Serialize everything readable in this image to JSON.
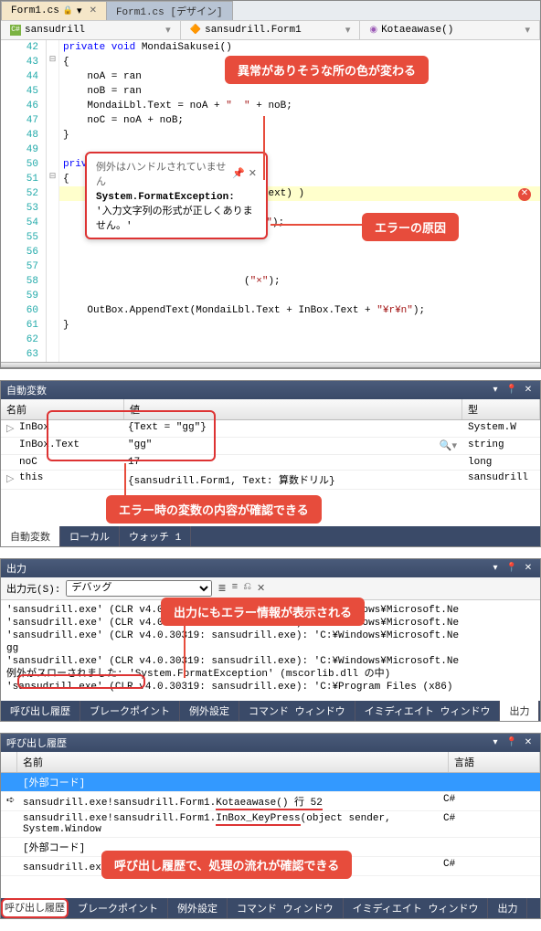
{
  "editor": {
    "tabs": [
      {
        "label": "Form1.cs",
        "active": true,
        "orange": true,
        "lock": true
      },
      {
        "label": "Form1.cs [デザイン]",
        "active": false
      }
    ],
    "breadcrumb": {
      "left": "sansudrill",
      "mid": "sansudrill.Form1",
      "right": "Kotaeawase()"
    },
    "lines": {
      "l42": "private void MondaiSakusei()",
      "l43": "{",
      "l44": "    noA = ran",
      "l45": "    noB = ran",
      "l46": "    MondaiLbl.Text = noA + \"  \" + noB;",
      "l47": "    noC = noA + noB;",
      "l48": "}",
      "l49": "",
      "l50": "private void Kotaeawase()",
      "l51": "{",
      "l52": "    if( noC == Int64.Parse(InBox.Text) )",
      "l53": "    {",
      "l54": "                              (\"〇\");",
      "l55": "",
      "l56": "",
      "l57": "",
      "l58": "                              (\"×\");",
      "l59": "",
      "l60": "    OutBox.AppendText(MondaiLbl.Text + InBox.Text + \"¥r¥n\");",
      "l61": "}",
      "l62": ""
    },
    "lineNums": [
      "42",
      "43",
      "44",
      "45",
      "46",
      "47",
      "48",
      "49",
      "50",
      "51",
      "52",
      "53",
      "54",
      "55",
      "56",
      "57",
      "58",
      "59",
      "60",
      "61",
      "62",
      "63"
    ],
    "tooltip": {
      "header": "例外はハンドルされていません",
      "msg1": "System.FormatException:",
      "msg2": "'入力文字列の形式が正しくありません。'"
    },
    "callout1": "異常がありそうな所の色が変わる",
    "callout2": "エラーの原因"
  },
  "autos": {
    "title": "自動変数",
    "hdr": {
      "name": "名前",
      "val": "値",
      "type": "型"
    },
    "rows": [
      {
        "name": "InBox",
        "val": "{Text = \"gg\"}",
        "type": "System.W"
      },
      {
        "name": "InBox.Text",
        "val": "\"gg\"",
        "type": "string",
        "mag": true
      },
      {
        "name": "noC",
        "val": "17",
        "type": "long"
      },
      {
        "name": "this",
        "val": "{sansudrill.Form1, Text: 算数ドリル}",
        "type": "sansudrill"
      }
    ],
    "callout": "エラー時の変数の内容が確認できる",
    "tabs": [
      "自動変数",
      "ローカル",
      "ウォッチ 1"
    ]
  },
  "output": {
    "title": "出力",
    "srcLabel": "出力元(S):",
    "srcVal": "デバッグ",
    "text": "'sansudrill.exe' (CLR v4.0.30319: sansudrill.exe): 'C:¥Windows¥Microsoft.Ne\n'sansudrill.exe' (CLR v4.0.30319: sansudrill.exe): 'C:¥Windows¥Microsoft.Ne\n'sansudrill.exe' (CLR v4.0.30319: sansudrill.exe): 'C:¥Windows¥Microsoft.Ne\ngg\n'sansudrill.exe' (CLR v4.0.30319: sansudrill.exe): 'C:¥Windows¥Microsoft.Ne\n例外がスローされました: 'System.FormatException' (mscorlib.dll の中)\n'sansudrill.exe' (CLR v4.0.30319: sansudrill.exe): 'C:¥Program Files (x86)",
    "callout": "出力にもエラー情報が表示される",
    "tabs": [
      "呼び出し履歴",
      "ブレークポイント",
      "例外設定",
      "コマンド ウィンドウ",
      "イミディエイト ウィンドウ",
      "出力"
    ]
  },
  "callstack": {
    "title": "呼び出し履歴",
    "hdr": {
      "name": "名前",
      "lang": "言語"
    },
    "rows": [
      {
        "name": "[外部コード]",
        "lang": "",
        "sel": true
      },
      {
        "name": "sansudrill.exe!sansudrill.Form1.Kotaeawase() 行 52",
        "lang": "C#",
        "cur": true
      },
      {
        "name": "sansudrill.exe!sansudrill.Form1.InBox_KeyPress(object sender, System.Window",
        "lang": "C#"
      },
      {
        "name": "[外部コード]",
        "lang": ""
      },
      {
        "name": "sansudrill.exe!sansudrill.Program.Main() 行 19",
        "lang": "C#"
      }
    ],
    "callout": "呼び出し履歴で、処理の流れが確認できる",
    "tabs": [
      "呼び出し履歴",
      "ブレークポイント",
      "例外設定",
      "コマンド ウィンドウ",
      "イミディエイト ウィンドウ",
      "出力"
    ],
    "activeTab": "呼び出し履歴"
  }
}
